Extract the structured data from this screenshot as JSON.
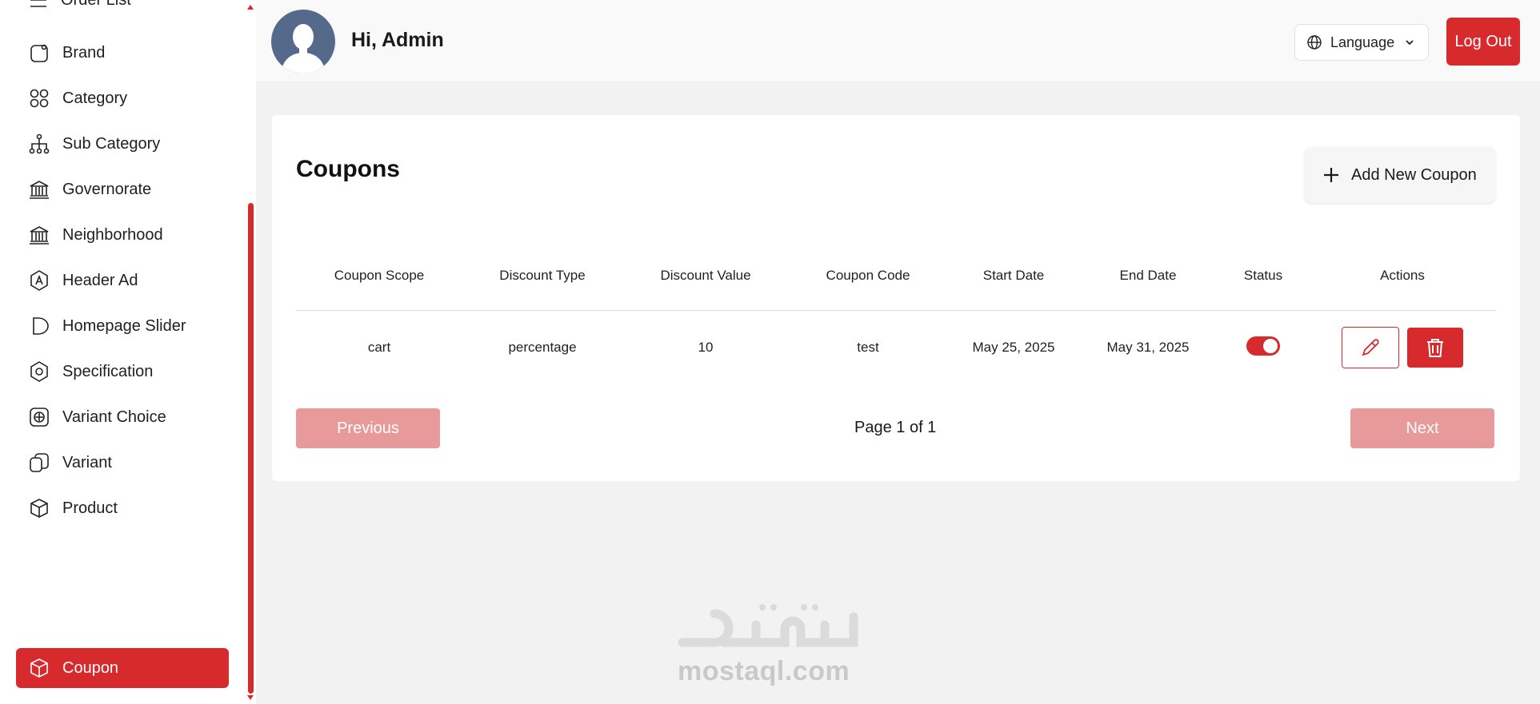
{
  "sidebar": {
    "partial_item": {
      "label": "Order List",
      "icon": "list-icon"
    },
    "items": [
      {
        "label": "Brand",
        "icon": "brand-icon"
      },
      {
        "label": "Category",
        "icon": "category-grid-icon"
      },
      {
        "label": "Sub Category",
        "icon": "hierarchy-icon"
      },
      {
        "label": "Governorate",
        "icon": "bank-icon"
      },
      {
        "label": "Neighborhood",
        "icon": "bank-icon"
      },
      {
        "label": "Header Ad",
        "icon": "ad-badge-icon"
      },
      {
        "label": "Homepage Slider",
        "icon": "slider-icon"
      },
      {
        "label": "Specification",
        "icon": "hexagon-nut-icon"
      },
      {
        "label": "Variant Choice",
        "icon": "plus-square-icon"
      },
      {
        "label": "Variant",
        "icon": "variant-icon"
      },
      {
        "label": "Product",
        "icon": "box-icon"
      },
      {
        "label": "Coupon",
        "icon": "box-icon",
        "active": true
      }
    ]
  },
  "header": {
    "greeting": "Hi, Admin",
    "language_label": "Language",
    "logout_label": "Log Out"
  },
  "main": {
    "title": "Coupons",
    "add_button_label": "Add New Coupon",
    "table": {
      "columns": [
        "Coupon Scope",
        "Discount Type",
        "Discount Value",
        "Coupon Code",
        "Start Date",
        "End Date",
        "Status",
        "Actions"
      ],
      "rows": [
        {
          "scope": "cart",
          "discount_type": "percentage",
          "discount_value": "10",
          "code": "test",
          "start_date": "May 25, 2025",
          "end_date": "May 31, 2025",
          "status_active": true
        }
      ]
    },
    "pagination": {
      "previous_label": "Previous",
      "next_label": "Next",
      "page_info": "Page 1 of 1"
    }
  },
  "watermark": {
    "text": "mostaql.com",
    "arabic_logo": "مستقل"
  },
  "colors": {
    "accent": "#d72a2c",
    "accent_disabled": "#e8999a",
    "background": "#f2f2f2"
  }
}
